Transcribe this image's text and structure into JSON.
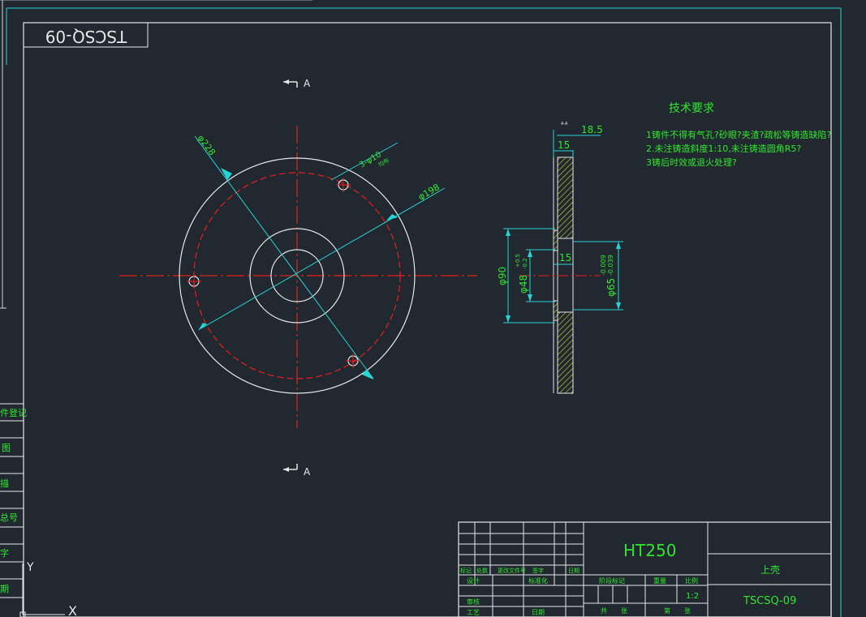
{
  "drawing": {
    "code_mirrored": "TSCSQ-09",
    "section_marker": "A",
    "section_view_label": "A-A",
    "ucs_y_label": "Y",
    "ucs_x_label": "X"
  },
  "dimensions": {
    "d228": "φ228",
    "d198": "φ198",
    "holes": "3-φ10",
    "holes_note": "均布",
    "w18_5": "18.5",
    "w15_top": "15",
    "w15_mid": "15",
    "d90": "φ90",
    "d48": "φ48",
    "d48_tol_upper": "+0.5",
    "d48_tol_lower": "-0.2",
    "d65": "φ65",
    "d65_tol_upper": "-0.009",
    "d65_tol_lower": "-0.039"
  },
  "tech_requirements": {
    "title": "技术要求",
    "items": [
      "1铸件不得有气孔?砂眼?夹渣?疏松等铸造缺陷?",
      "2.未注铸造斜度1:10,未注铸造圆角R5?",
      "3铸后时效或退火处理?"
    ]
  },
  "left_strip": {
    "labels": [
      "件登记",
      "图",
      "描",
      "总号",
      "字",
      "期"
    ]
  },
  "title_block": {
    "material": "HT250",
    "part_name": "上壳",
    "drawing_number": "TSCSQ-09",
    "scale": "1:2",
    "header_row": [
      "标记",
      "处数",
      "更改文件号",
      "签字",
      "日期"
    ],
    "design_label": "设计",
    "standard_label": "标准化",
    "review_label": "审核",
    "process_label": "工艺",
    "date_label": "日期",
    "stage_label": "阶段标记",
    "weight_label": "重量",
    "ratio_label": "比例",
    "sheets_total_label": "共",
    "sheets_label": "张",
    "sheet_no_label": "第",
    "sheet_no_suffix": "张"
  },
  "colors": {
    "background": "#212830",
    "frame": "#27d3d3",
    "outline": "#e6e6e6",
    "centerline": "#e61e1e",
    "dimension": "#27d3d3",
    "text": "#2ee62e",
    "hatch": "#d6d62e"
  }
}
